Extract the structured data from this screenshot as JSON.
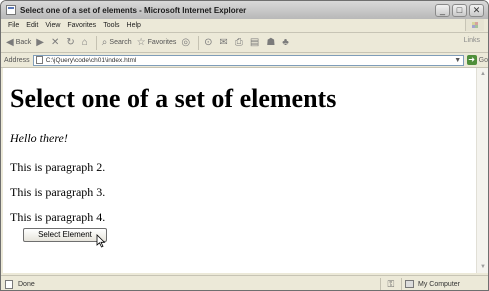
{
  "window": {
    "title": "Select one of a set of elements - Microsoft Internet Explorer",
    "buttons": [
      "_",
      "□",
      "✕"
    ]
  },
  "menu": [
    "File",
    "Edit",
    "View",
    "Favorites",
    "Tools",
    "Help"
  ],
  "toolbar": {
    "back": "Back",
    "search": "Search",
    "favorites": "Favorites",
    "links": "Links"
  },
  "address": {
    "label": "Address",
    "url": "C:\\jQuery\\code\\ch01\\index.html",
    "go": "Go"
  },
  "page": {
    "heading": "Select one of a set of elements",
    "paragraphs": [
      "Hello there!",
      "This is paragraph 2.",
      "This is paragraph 3.",
      "This is paragraph 4."
    ],
    "button_label": "Select Element"
  },
  "status": {
    "text": "Done",
    "zone": "My Computer"
  }
}
